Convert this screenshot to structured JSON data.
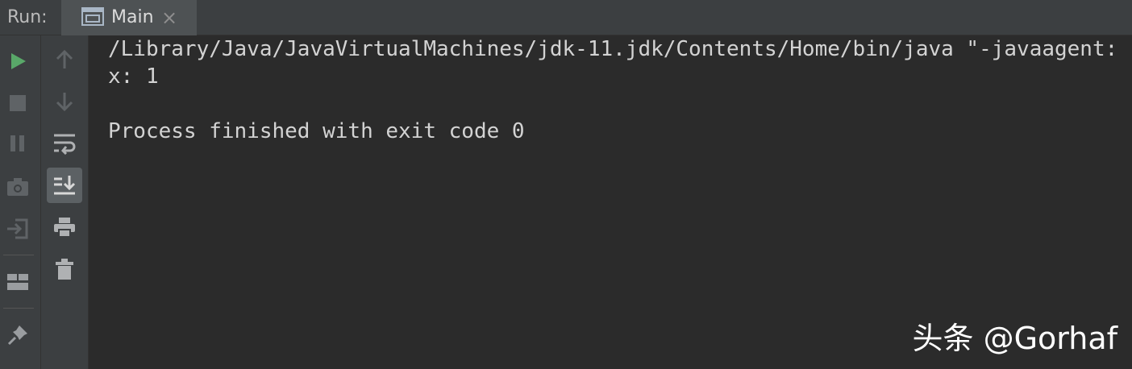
{
  "header": {
    "run_label": "Run:",
    "tab": {
      "label": "Main",
      "close_glyph": "×",
      "icon": "console-window-icon"
    }
  },
  "toolbar_left": [
    {
      "name": "rerun-icon",
      "color": "#59a869"
    },
    {
      "name": "stop-icon",
      "color": "#5f6366"
    },
    {
      "name": "pause-icon",
      "color": "#5f6366"
    },
    {
      "name": "camera-icon",
      "color": "#5f6366"
    },
    {
      "name": "exit-icon",
      "color": "#5f6366"
    },
    {
      "name": "layout-icon",
      "color": "#9a9da0"
    },
    {
      "name": "pin-icon",
      "color": "#9a9da0"
    }
  ],
  "toolbar_right": [
    {
      "name": "arrow-up-icon",
      "color": "#5f6366"
    },
    {
      "name": "arrow-down-icon",
      "color": "#5f6366"
    },
    {
      "name": "soft-wrap-icon",
      "color": "#afb1b3"
    },
    {
      "name": "scroll-to-end-icon",
      "color": "#afb1b3",
      "active": true
    },
    {
      "name": "print-icon",
      "color": "#afb1b3"
    },
    {
      "name": "trash-icon",
      "color": "#afb1b3"
    }
  ],
  "console": {
    "lines": [
      "/Library/Java/JavaVirtualMachines/jdk-11.jdk/Contents/Home/bin/java \"-javaagent:",
      "x: 1",
      "",
      "Process finished with exit code 0"
    ]
  },
  "watermark": "头条 @Gorhaf"
}
